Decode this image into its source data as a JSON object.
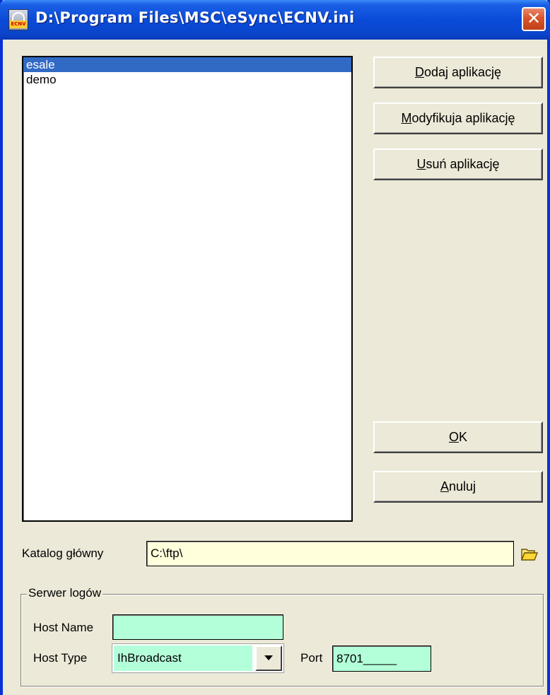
{
  "window": {
    "title": "D:\\Program Files\\MSC\\eSync\\ECNV.ini",
    "icon": "ecnv-app-icon",
    "icon_text": "ECNV"
  },
  "applications": {
    "items": [
      {
        "label": "esale",
        "selected": true
      },
      {
        "label": "demo",
        "selected": false
      }
    ]
  },
  "buttons": {
    "add": {
      "key": "D",
      "rest": "odaj aplikację"
    },
    "modify": {
      "key": "M",
      "rest": "odyfikuja aplikację"
    },
    "remove": {
      "key": "U",
      "rest": "suń aplikację"
    },
    "ok": {
      "key": "O",
      "rest": "K"
    },
    "cancel": {
      "key": "A",
      "rest": "nuluj"
    }
  },
  "root_dir": {
    "label": "Katalog główny",
    "value": "C:\\ftp\\"
  },
  "log_server": {
    "legend": "Serwer logów",
    "host_name_label": "Host Name",
    "host_name_value": "",
    "host_type_label": "Host Type",
    "host_type_value": "IhBroadcast",
    "port_label": "Port",
    "port_value": "8701_____"
  },
  "colors": {
    "titlebar": "#0a4bd8",
    "selection": "#316ac5",
    "dir_input_bg": "#ffffdc",
    "log_field_bg": "#b3ffd9",
    "dialog_bg": "#ece9d8"
  }
}
